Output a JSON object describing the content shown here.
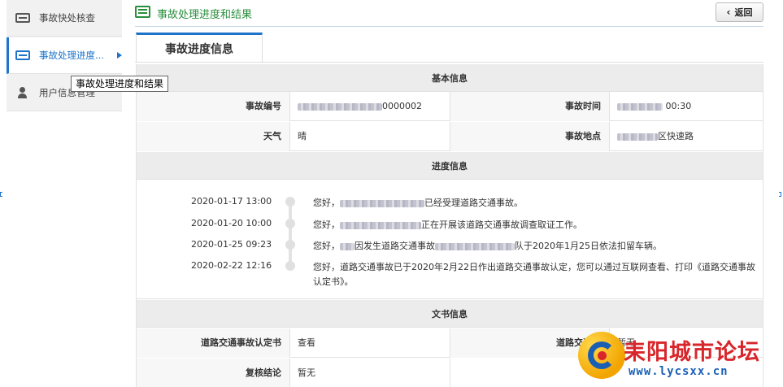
{
  "sidebar": {
    "items": [
      {
        "label": "事故快处核查",
        "icon": "card-icon"
      },
      {
        "label": "事故处理进度...",
        "icon": "card-icon"
      },
      {
        "label": "用户信息管理",
        "icon": "user-icon"
      }
    ],
    "tooltip": "事故处理进度和结果"
  },
  "header": {
    "title": "事故处理进度和结果",
    "back_label": "返回"
  },
  "tab": {
    "label": "事故进度信息"
  },
  "basic": {
    "section_title": "基本信息",
    "accident_no_label": "事故编号",
    "accident_no_suffix": "0000002",
    "accident_time_label": "事故时间",
    "accident_time_suffix": "00:30",
    "weather_label": "天气",
    "weather_value": "晴",
    "location_label": "事故地点",
    "location_suffix": "区快速路"
  },
  "progress": {
    "section_title": "进度信息",
    "events": [
      {
        "time": "2020-01-17 13:00",
        "prefix": "您好，",
        "text": "已经受理道路交通事故。"
      },
      {
        "time": "2020-01-20 10:00",
        "prefix": "您好，",
        "text": "正在开展该道路交通事故调查取证工作。"
      },
      {
        "time": "2020-01-25 09:23",
        "prefix": "您好，",
        "mid": "因发生道路交通事故",
        "text": "队于2020年1月25日依法扣留车辆。"
      },
      {
        "time": "2020-02-22 12:16",
        "prefix": "",
        "text": "您好，道路交通事故已于2020年2月22日作出道路交通事故认定，您可以通过互联网查看、打印《道路交通事故认定书》。"
      }
    ]
  },
  "documents": {
    "section_title": "文书信息",
    "cert_label": "道路交通事故认定书",
    "cert_value": "查看",
    "right_label": "道路交通事",
    "right_value": "暂无",
    "review_label": "复核结论",
    "review_value": "暂无"
  },
  "watermark": {
    "title": "耒阳城市论坛",
    "url": "www.lycsxx.cn"
  },
  "colors": {
    "accent": "#1e74c9",
    "header_green": "#2a8f3d",
    "section_bg": "#ececec"
  }
}
